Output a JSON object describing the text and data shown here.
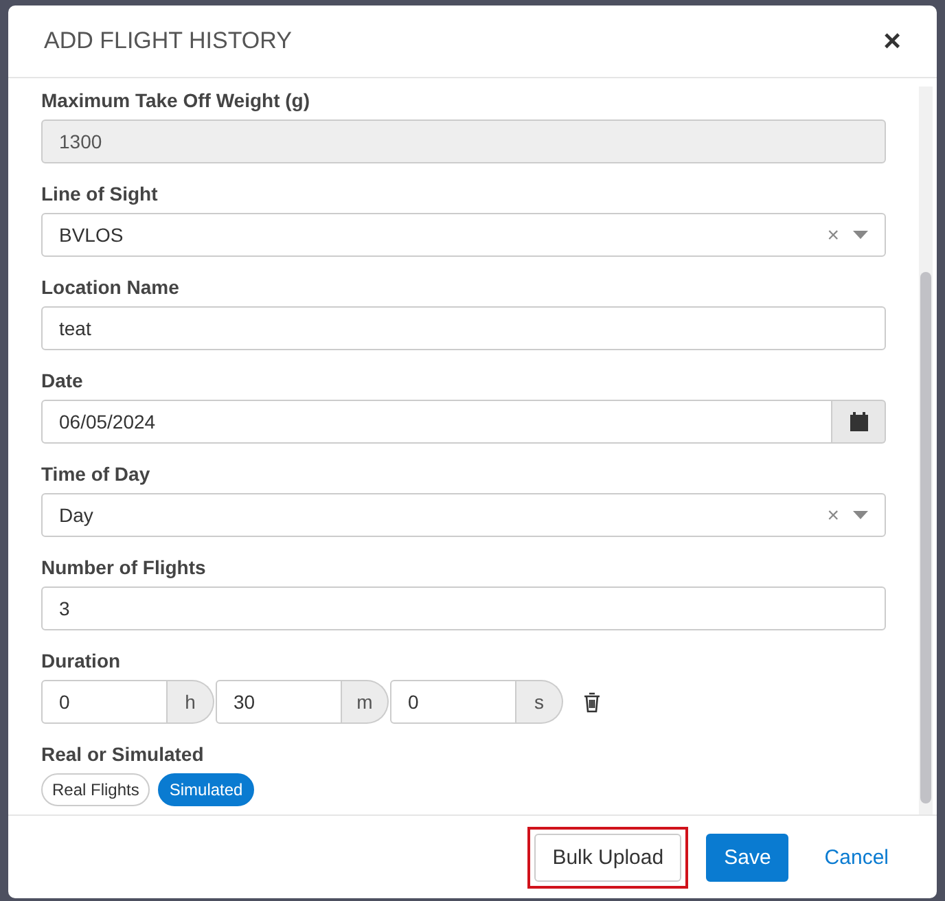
{
  "dialog": {
    "title": "ADD FLIGHT HISTORY",
    "close": "×"
  },
  "fields": [
    {
      "kind": "text",
      "label": "Maximum Take Off Weight (g)",
      "value": "1300",
      "disabled": true
    },
    {
      "kind": "select",
      "label": "Line of Sight",
      "value": "BVLOS",
      "clear": "×"
    },
    {
      "kind": "text",
      "label": "Location Name",
      "value": "teat",
      "disabled": false
    },
    {
      "kind": "date",
      "label": "Date",
      "value": "06/05/2024"
    },
    {
      "kind": "select",
      "label": "Time of Day",
      "value": "Day",
      "clear": "×"
    },
    {
      "kind": "text",
      "label": "Number of Flights",
      "value": "3",
      "disabled": false
    },
    {
      "kind": "duration",
      "label": "Duration",
      "parts": [
        {
          "value": "0",
          "unit": "h"
        },
        {
          "value": "30",
          "unit": "m"
        },
        {
          "value": "0",
          "unit": "s"
        }
      ]
    },
    {
      "kind": "toggle",
      "label": "Real or Simulated",
      "options": [
        {
          "label": "Real Flights",
          "selected": false
        },
        {
          "label": "Simulated",
          "selected": true
        }
      ]
    }
  ],
  "buttons": [
    {
      "kind": "default",
      "label": "Bulk Upload",
      "highlighted": true
    },
    {
      "kind": "primary",
      "label": "Save",
      "highlighted": false
    },
    {
      "kind": "link",
      "label": "Cancel",
      "highlighted": false
    }
  ]
}
